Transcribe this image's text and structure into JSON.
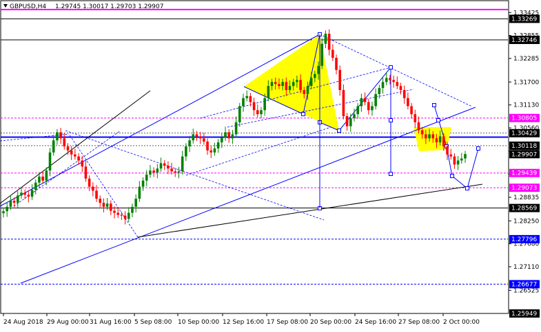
{
  "header": {
    "symbol_label": "GBPUSD,H4",
    "ohlc_text": "1.29745 1.30017 1.29703 1.29907",
    "arrow_icon": "dropdown-triangle-icon"
  },
  "colors": {
    "up_candle": "#008000",
    "down_candle": "#ff0000",
    "trend_line": "#0000ff",
    "magenta_line": "#ff00ff",
    "black_line": "#000000",
    "triangle_fill": "#ffff00"
  },
  "price_scale": {
    "ticks": [
      "1.33425",
      "1.32855",
      "1.32285",
      "1.31700",
      "1.31130",
      "1.30560",
      "1.29985",
      "1.29415",
      "1.28835",
      "1.28250",
      "1.27680",
      "1.27110",
      "1.26525"
    ]
  },
  "price_tags": {
    "black": [
      "1.33269",
      "1.32746",
      "1.28569",
      "1.30429",
      "1.30118",
      "1.29907",
      "1.25949"
    ],
    "magenta": [
      "1.30805",
      "1.29439",
      "1.29073"
    ],
    "blue": [
      "1.27796",
      "1.26677"
    ]
  },
  "time_scale": {
    "ticks": [
      "24 Aug 2018",
      "29 Aug 00:00",
      "31 Aug 16:00",
      "5 Sep 08:00",
      "10 Sep 00:00",
      "12 Sep 16:00",
      "17 Sep 08:00",
      "20 Sep 00:00",
      "24 Sep 16:00",
      "27 Sep 08:00",
      "2 Oct 00:00"
    ]
  },
  "chart_data": {
    "type": "candlestick",
    "symbol": "GBPUSD",
    "timeframe": "H4",
    "last_bar": {
      "open": 1.29745,
      "high": 1.30017,
      "low": 1.29703,
      "close": 1.29907
    },
    "y_range": [
      1.2595,
      1.3372
    ],
    "horizontal_levels": {
      "magenta": [
        1.335,
        1.30805,
        1.29439,
        1.29073
      ],
      "black": [
        1.33269,
        1.32746,
        1.28569
      ],
      "blue_dashed": [
        1.27796,
        1.26677
      ],
      "blue_solid": [
        1.3033
      ],
      "dashed_grey": [
        1.30429,
        1.30118
      ]
    },
    "closes": [
      1.2849,
      1.286,
      1.2875,
      1.287,
      1.2888,
      1.2895,
      1.289,
      1.2885,
      1.2902,
      1.292,
      1.2935,
      1.2925,
      1.295,
      1.2995,
      1.3025,
      1.3045,
      1.303,
      1.301,
      1.3,
      1.299,
      1.2985,
      1.2975,
      1.296,
      1.293,
      1.291,
      1.29,
      1.288,
      1.287,
      1.286,
      1.2868,
      1.285,
      1.2845,
      1.284,
      1.2838,
      1.283,
      1.2845,
      1.286,
      1.288,
      1.291,
      1.2925,
      1.294,
      1.295,
      1.2945,
      1.2955,
      1.2968,
      1.2962,
      1.2955,
      1.2948,
      1.2945,
      1.2948,
      1.2985,
      1.301,
      1.3025,
      1.304,
      1.3035,
      1.303,
      1.3022,
      1.3,
      1.2995,
      1.3005,
      1.302,
      1.3032,
      1.3045,
      1.303,
      1.304,
      1.307,
      1.311,
      1.313,
      1.3135,
      1.312,
      1.31,
      1.309,
      1.31,
      1.313,
      1.316,
      1.317,
      1.3165,
      1.316,
      1.317,
      1.315,
      1.316,
      1.317,
      1.3175,
      1.315,
      1.314,
      1.316,
      1.318,
      1.319,
      1.321,
      1.3265,
      1.329,
      1.325,
      1.323,
      1.32,
      1.315,
      1.3085,
      1.306,
      1.308,
      1.309,
      1.311,
      1.313,
      1.312,
      1.31,
      1.311,
      1.314,
      1.3155,
      1.317,
      1.318,
      1.3175,
      1.317,
      1.316,
      1.315,
      1.313,
      1.311,
      1.309,
      1.307,
      1.305,
      1.304,
      1.303,
      1.304,
      1.303,
      1.302,
      1.3035,
      1.301,
      1.299,
      1.2985,
      1.2965,
      1.2975,
      1.298,
      1.2991
    ]
  }
}
